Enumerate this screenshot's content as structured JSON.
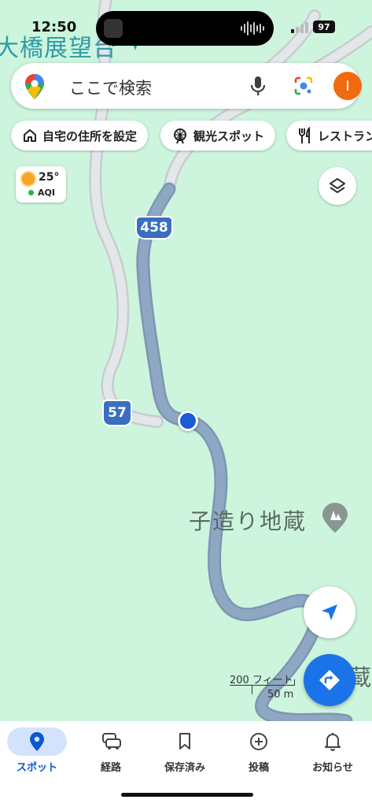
{
  "status_bar": {
    "time": "12:50",
    "battery": "97"
  },
  "search": {
    "placeholder": "ここで検索",
    "avatar_initial": "I"
  },
  "chips": [
    {
      "label": "自宅の住所を設定",
      "icon": "home-icon"
    },
    {
      "label": "観光スポット",
      "icon": "ferris-wheel-icon"
    },
    {
      "label": "レストラン",
      "icon": "fork-knife-icon"
    }
  ],
  "weather": {
    "temp": "25°",
    "aqi_label": "AQI",
    "aqi_color": "#1db94a"
  },
  "map": {
    "labels": {
      "title_top": "大橋展望台",
      "poi": "子造り地蔵",
      "edge_text": "蔵"
    },
    "route_shields": [
      "458",
      "57"
    ],
    "scale": {
      "imperial": "200 フィート",
      "metric": "50 m"
    },
    "colors": {
      "background": "#cdf5dd",
      "route": "#8aa3bf",
      "road": "#e2e6ea",
      "location": "#1a5bd8"
    }
  },
  "nav": {
    "items": [
      {
        "label": "スポット",
        "icon": "location-pin-icon",
        "active": true
      },
      {
        "label": "経路",
        "icon": "car-icon",
        "active": false
      },
      {
        "label": "保存済み",
        "icon": "bookmark-icon",
        "active": false
      },
      {
        "label": "投稿",
        "icon": "add-circle-icon",
        "active": false
      },
      {
        "label": "お知らせ",
        "icon": "bell-icon",
        "active": false
      }
    ],
    "active_color": "#0b57d0"
  }
}
